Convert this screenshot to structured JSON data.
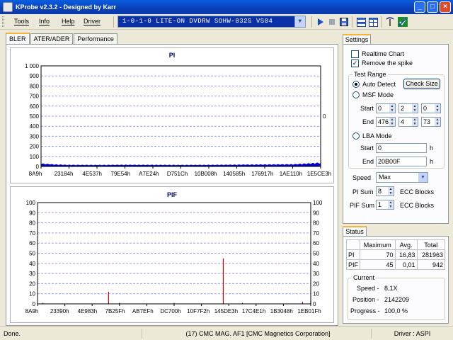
{
  "window": {
    "title": "KProbe v2.3.2 - Designed by Karr"
  },
  "menu": [
    "Tools",
    "Info",
    "Help",
    "Driver"
  ],
  "drive": "1-0-1-0 LITE-ON DVDRW SOHW-832S  VS04",
  "tabs": [
    "BLER",
    "ATER/ADER",
    "Performance"
  ],
  "toolbar_icons": [
    "play-icon",
    "stop-icon",
    "save-icon",
    "layout-horizontal-icon",
    "layout-grid-icon",
    "antenna-icon",
    "disc-check-icon"
  ],
  "colors": {
    "pi": "#0000cc",
    "pif": "#cc0000",
    "grid": "#9a9aff",
    "accent": "#0b31a8"
  },
  "charts": {
    "pi": {
      "title": "PI",
      "y_ticks": [
        "1 000",
        "900",
        "800",
        "700",
        "600",
        "500",
        "400",
        "300",
        "200",
        "100",
        "0"
      ],
      "right_tick": "0",
      "x_labels": [
        "8A9h",
        "23184h",
        "4E537h",
        "79E54h",
        "A7E24h",
        "D751Ch",
        "10B008h",
        "140585h",
        "176917h",
        "1AE110h",
        "1E5CE3h"
      ]
    },
    "pif": {
      "title": "PIF",
      "y_ticks": [
        "100",
        "90",
        "80",
        "70",
        "60",
        "50",
        "40",
        "30",
        "20",
        "10",
        "0"
      ],
      "x_labels": [
        "8A9h",
        "23390h",
        "4E983h",
        "7B25Fh",
        "AB7EFh",
        "DC700h",
        "10F7F2h",
        "145DE3h",
        "17C4E1h",
        "1B3048h",
        "1EB01Fh"
      ]
    }
  },
  "chart_data": [
    {
      "type": "area",
      "title": "PI",
      "x_range": [
        "8A9h",
        "1E5CE3h"
      ],
      "ylim": [
        0,
        1000
      ],
      "grid": true,
      "series": [
        {
          "name": "PI",
          "x": [
            0,
            0.05,
            0.1,
            0.2,
            0.3,
            0.4,
            0.5,
            0.6,
            0.7,
            0.8,
            0.9,
            0.95,
            1.0
          ],
          "values": [
            30,
            20,
            16,
            15,
            17,
            16,
            15,
            16,
            18,
            20,
            22,
            30,
            40
          ]
        }
      ]
    },
    {
      "type": "bar",
      "title": "PIF",
      "x_range": [
        "8A9h",
        "1EB01Fh"
      ],
      "ylim": [
        0,
        100
      ],
      "grid": true,
      "series": [
        {
          "name": "PIF",
          "x": [
            0.02,
            0.26,
            0.3,
            0.5,
            0.68,
            0.75,
            0.97,
            1.0
          ],
          "values": [
            1,
            12,
            1,
            1,
            45,
            1,
            2,
            3
          ]
        }
      ]
    }
  ],
  "settings": {
    "tab": "Settings",
    "realtime_chart": "Realtime Chart",
    "remove_spike": "Remove the spike",
    "test_range": "Test Range",
    "auto_detect": "Auto Detect",
    "check_size": "Check Size",
    "msf_mode": "MSF Mode",
    "start_label": "Start",
    "end_label": "End",
    "msf_start": [
      "0",
      "2",
      "0"
    ],
    "msf_end": [
      "476",
      "4",
      "73"
    ],
    "lba_mode": "LBA Mode",
    "lba_start": "0",
    "lba_end": "20B00F",
    "h": "h",
    "speed_label": "Speed",
    "speed": "Max",
    "pi_sum_label": "PI Sum",
    "pi_sum": "8",
    "pif_sum_label": "PIF Sum",
    "pif_sum": "1",
    "ecc": "ECC Blocks"
  },
  "status": {
    "tab": "Status",
    "headers": [
      "Maximum",
      "Avg.",
      "Total"
    ],
    "rows": [
      {
        "name": "PI",
        "max": "70",
        "avg": "16,83",
        "total": "281963"
      },
      {
        "name": "PIF",
        "max": "45",
        "avg": "0,01",
        "total": "942"
      }
    ],
    "current": "Current",
    "speed_label": "Speed -",
    "speed": "8,1X",
    "position_label": "Position -",
    "position": "2142209",
    "progress_label": "Progress -",
    "progress": "100,0 %"
  },
  "statusbar": {
    "left": "Done.",
    "center": "(17) CMC MAG. AF1 [CMC Magnetics Corporation]",
    "right": "Driver : ASPI"
  }
}
